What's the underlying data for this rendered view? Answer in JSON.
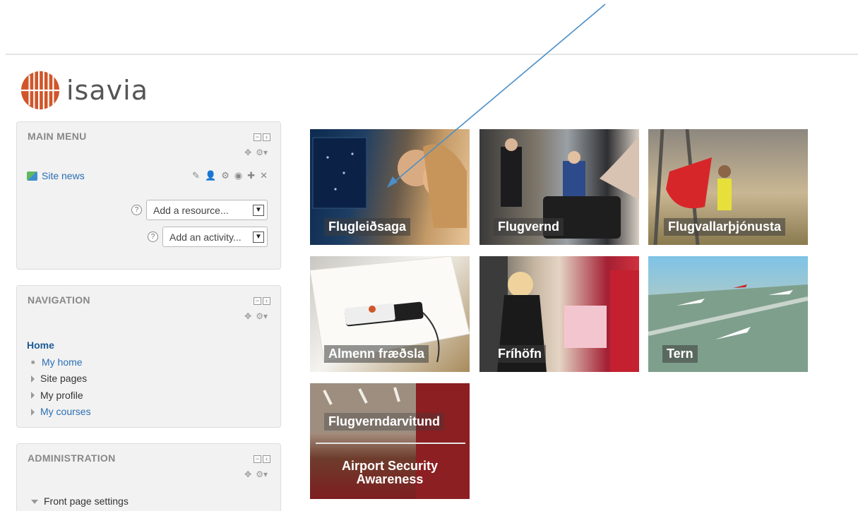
{
  "brand": {
    "name": "isavia",
    "logo_color": "#d0562a"
  },
  "main_menu": {
    "title": "MAIN MENU",
    "site_news": "Site news",
    "add_resource": "Add a resource...",
    "add_activity": "Add an activity...",
    "help_symbol": "?"
  },
  "navigation": {
    "title": "NAVIGATION",
    "home": "Home",
    "items": [
      "My home",
      "Site pages",
      "My profile",
      "My courses"
    ]
  },
  "administration": {
    "title": "ADMINISTRATION",
    "items": [
      "Front page settings"
    ]
  },
  "tiles": [
    {
      "label": "Flugleiðsaga"
    },
    {
      "label": "Flugvernd"
    },
    {
      "label": "Flugvallarþjónusta"
    },
    {
      "label": "Almenn fræðsla"
    },
    {
      "label": "Fríhöfn"
    },
    {
      "label": "Tern"
    },
    {
      "label": "Flugverndarvitund",
      "label2": "Airport Security Awareness"
    }
  ],
  "colors": {
    "link": "#2a6fb5",
    "home": "#1c5a94",
    "arrow": "#4a8fc9"
  }
}
